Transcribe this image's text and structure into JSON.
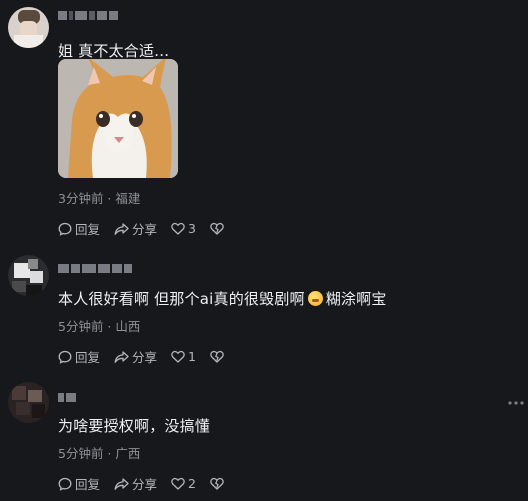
{
  "comments": [
    {
      "text": "姐 真不太合适…",
      "meta": "3分钟前 · 福建",
      "actions": {
        "comment": "回复",
        "share": "分享",
        "like_count": "3"
      }
    },
    {
      "text_before": "本人很好看啊 但那个ai真的很毁剧啊",
      "text_after": "糊涂啊宝",
      "meta": "5分钟前 · 山西",
      "actions": {
        "comment": "回复",
        "share": "分享",
        "like_count": "1"
      }
    },
    {
      "text": "为啥要授权啊，没搞懂",
      "meta": "5分钟前 · 广西",
      "actions": {
        "comment": "回复",
        "share": "分享",
        "like_count": "2"
      }
    }
  ],
  "colors": {
    "background": "#16181c",
    "text": "#eef0f3",
    "meta": "#8d9097",
    "action": "#b3b6bc"
  },
  "icons": [
    "comment-bubble-icon",
    "share-arrow-icon",
    "heart-icon",
    "dislike-heart-icon",
    "more-dots-icon"
  ]
}
